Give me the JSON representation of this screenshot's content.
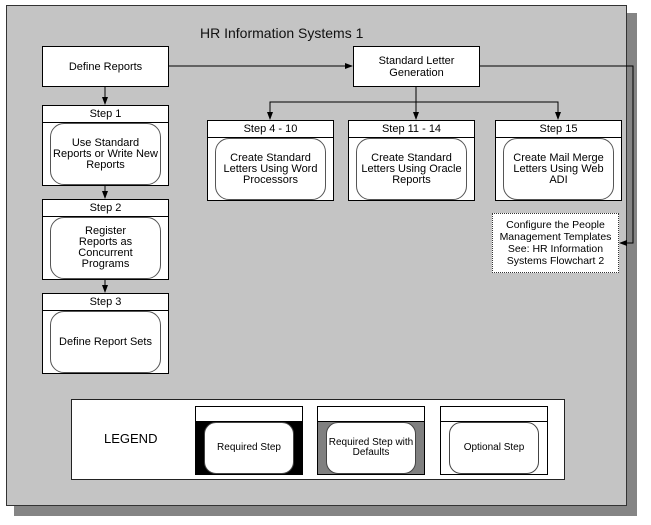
{
  "title": "HR Information Systems 1",
  "nodes": {
    "define_reports": "Define Reports",
    "standard_letter_generation": "Standard Letter Generation"
  },
  "steps": [
    {
      "header": "Step 1",
      "label": "Use Standard Reports or Write New Reports",
      "type": "optional"
    },
    {
      "header": "Step 2",
      "label": "Register Reports as Concurrent Programs",
      "type": "optional"
    },
    {
      "header": "Step 3",
      "label": "Define Report Sets",
      "type": "optional"
    },
    {
      "header": "Step 4 - 10",
      "label": "Create Standard Letters Using Word Processors",
      "type": "optional"
    },
    {
      "header": "Step 11 - 14",
      "label": "Create Standard Letters Using Oracle Reports",
      "type": "optional"
    },
    {
      "header": "Step 15",
      "label": "Create Mail Merge Letters Using Web ADI",
      "type": "optional"
    }
  ],
  "reference_note": "Configure the People Management Templates See: HR Information Systems Flowchart 2",
  "legend": {
    "label": "LEGEND",
    "items": [
      {
        "label": "Required Step",
        "fill": "#000000"
      },
      {
        "label": "Required Step with Defaults",
        "fill": "#808080"
      },
      {
        "label": "Optional Step",
        "fill": "#ffffff"
      }
    ]
  }
}
